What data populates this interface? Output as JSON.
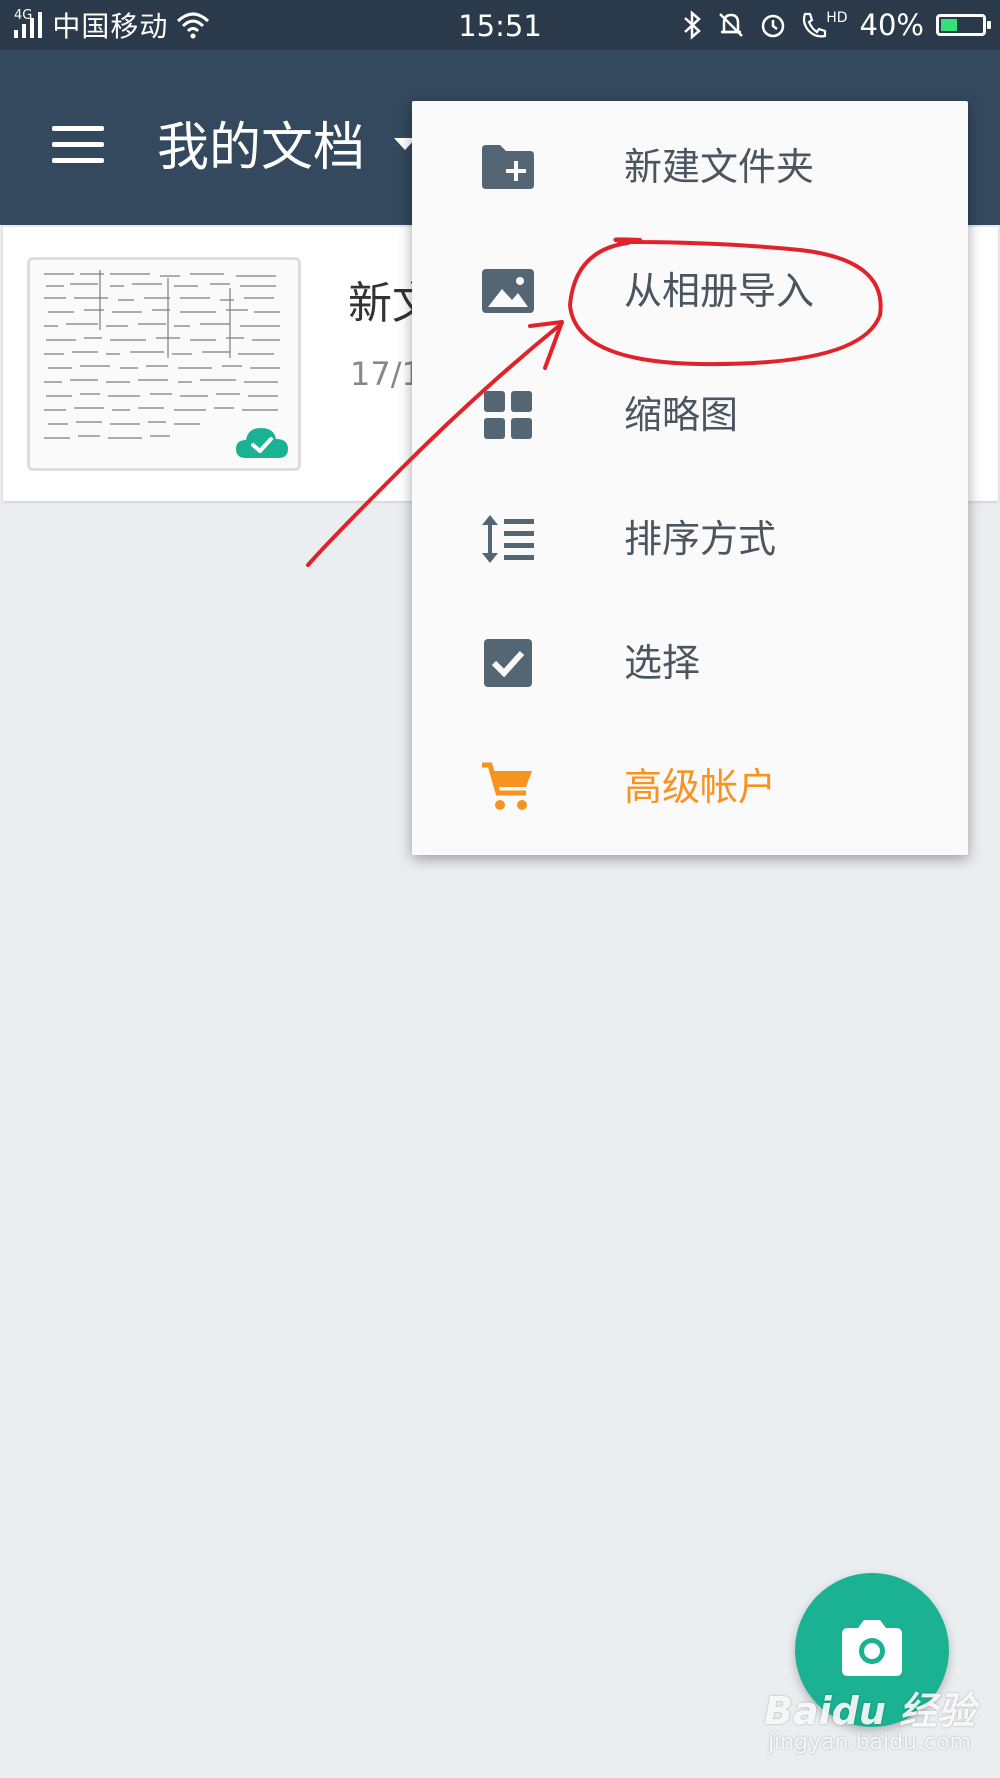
{
  "status_bar": {
    "network": "4G",
    "carrier": "中国移动",
    "time": "15:51",
    "hd_label": "HD",
    "battery": "40%",
    "battery_level": 0.4
  },
  "app_bar": {
    "title": "我的文档"
  },
  "document": {
    "name": "新文",
    "date": "17/1"
  },
  "menu": {
    "items": [
      {
        "label": "新建文件夹",
        "icon": "folder-add-icon"
      },
      {
        "label": "从相册导入",
        "icon": "image-icon"
      },
      {
        "label": "缩略图",
        "icon": "grid-icon"
      },
      {
        "label": "排序方式",
        "icon": "sort-icon"
      },
      {
        "label": "选择",
        "icon": "checkbox-icon"
      },
      {
        "label": "高级帐户",
        "icon": "cart-icon"
      }
    ]
  },
  "watermark": {
    "logo": "Baidu 经验",
    "url": "jingyan.baidu.com"
  },
  "colors": {
    "app_bar": "#34495e",
    "status_bar": "#2b3a4a",
    "accent_fab": "#1bb193",
    "premium": "#f7931e",
    "annotation": "#e0232b",
    "icon": "#546574"
  }
}
